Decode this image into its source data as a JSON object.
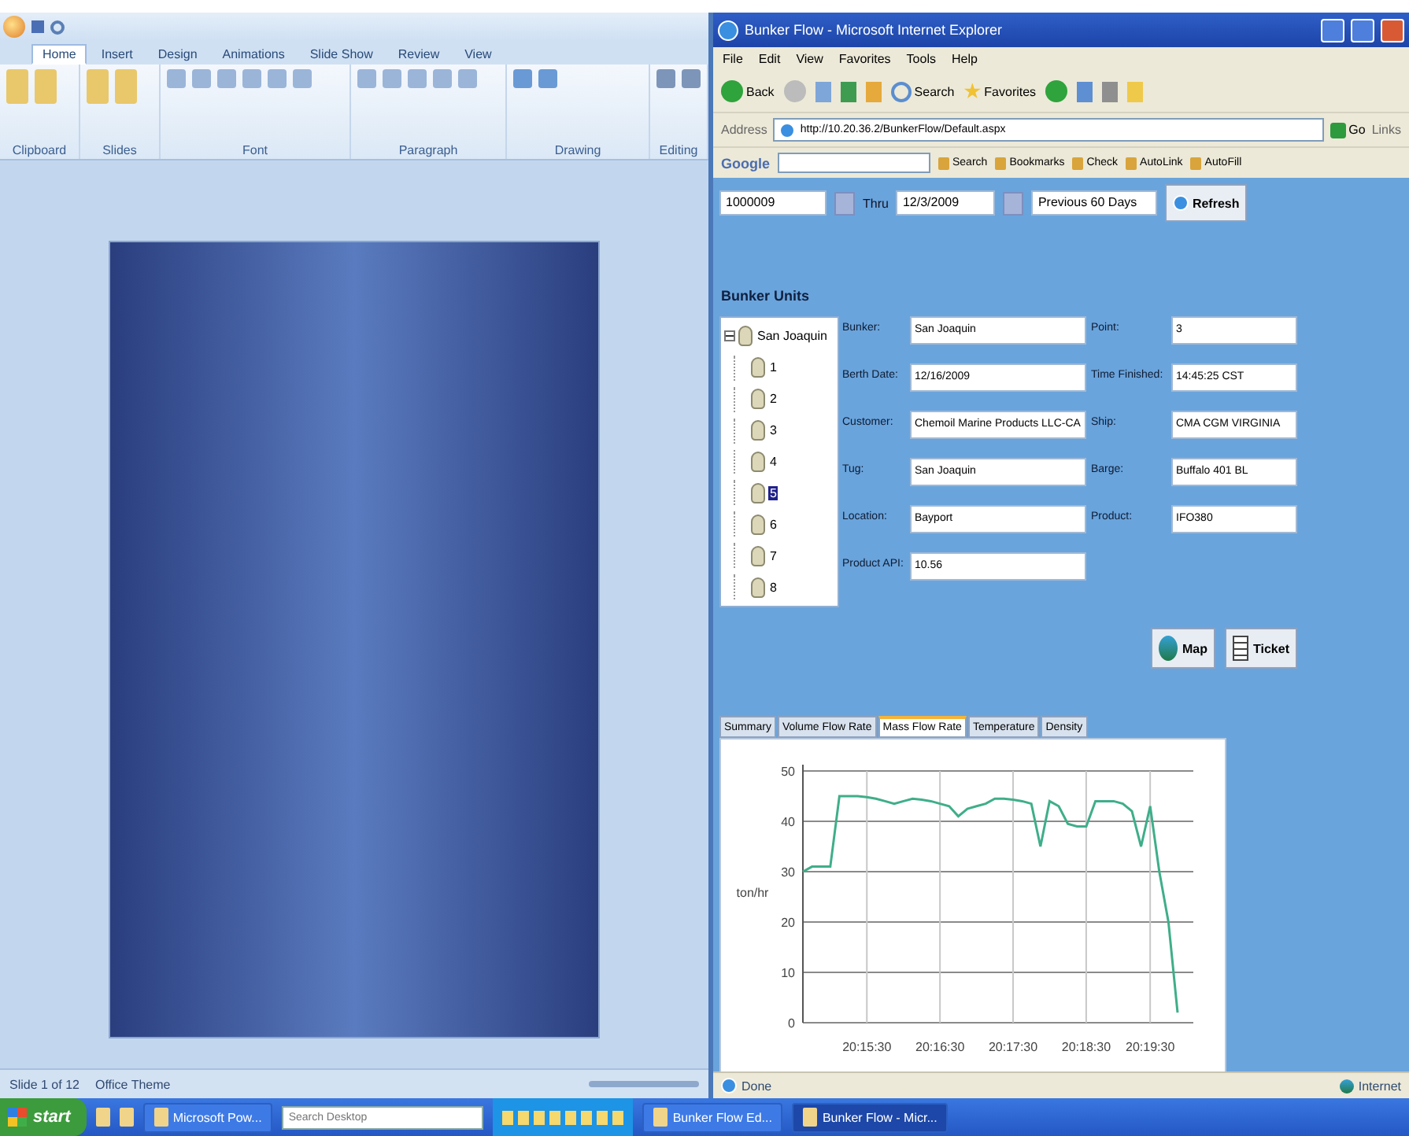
{
  "ppt_window": {
    "ribbon_tabs": [
      {
        "label": "Home",
        "selected": true
      },
      {
        "label": "Insert",
        "selected": false
      },
      {
        "label": "Design",
        "selected": false
      },
      {
        "label": "Animations",
        "selected": false
      },
      {
        "label": "Slide Show",
        "selected": false
      },
      {
        "label": "Review",
        "selected": false
      },
      {
        "label": "View",
        "selected": false
      }
    ],
    "ribbon_groups": [
      "Clipboard",
      "Slides",
      "Font",
      "Paragraph",
      "Drawing",
      "Editing"
    ],
    "status_bar": {
      "slide": "Slide 1 of 12",
      "theme": "Office Theme"
    }
  },
  "ie_window": {
    "title": "Bunker Flow - Microsoft Internet Explorer",
    "menu": [
      "File",
      "Edit",
      "View",
      "Favorites",
      "Tools",
      "Help"
    ],
    "toolbar": [
      "Back",
      "Search",
      "Favorites"
    ],
    "address": {
      "label": "Address",
      "value": "http://10.20.36.2/BunkerFlow/Default.aspx",
      "go": "Go",
      "links": "Links"
    },
    "google_toolbar": {
      "label": "Google",
      "buttons": [
        "Search",
        "Bookmarks",
        "Check",
        "AutoLink",
        "AutoFill"
      ]
    },
    "status_bar": {
      "left": "Done",
      "right": "Internet"
    }
  },
  "filter": {
    "from": "1000009",
    "thru_label": "Thru",
    "thru": "12/3/2009",
    "range": "Previous 60 Days",
    "refresh": "Refresh"
  },
  "section_title": "Bunker Units",
  "tree": {
    "label": "San Joaquin",
    "expanded": true,
    "children": [
      {
        "label": "1",
        "selected": false
      },
      {
        "label": "2",
        "selected": false
      },
      {
        "label": "3",
        "selected": false
      },
      {
        "label": "4",
        "selected": false
      },
      {
        "label": "5",
        "selected": true
      },
      {
        "label": "6",
        "selected": false
      },
      {
        "label": "7",
        "selected": false
      },
      {
        "label": "8",
        "selected": false
      }
    ]
  },
  "fields": [
    {
      "label": "Bunker:",
      "value": "San Joaquin"
    },
    {
      "label": "Point:",
      "value": "3"
    },
    {
      "label": "Berth Date:",
      "value": "12/16/2009"
    },
    {
      "label": "Time Finished:",
      "value": "14:45:25 CST"
    },
    {
      "label": "Customer:",
      "value": "Chemoil Marine Products LLC-CA"
    },
    {
      "label": "Ship:",
      "value": "CMA CGM VIRGINIA"
    },
    {
      "label": "Tug:",
      "value": "San Joaquin"
    },
    {
      "label": "Barge:",
      "value": "Buffalo 401 BL"
    },
    {
      "label": "Location:",
      "value": "Bayport"
    },
    {
      "label": "Product:",
      "value": "IFO380"
    },
    {
      "label": "Product API:",
      "value": "10.56"
    }
  ],
  "actions": [
    {
      "label": "Map",
      "kind": "map"
    },
    {
      "label": "Ticket",
      "kind": "ticket"
    }
  ],
  "chart_tabs": [
    {
      "label": "Summary",
      "selected": false
    },
    {
      "label": "Volume Flow Rate",
      "selected": false
    },
    {
      "label": "Mass Flow Rate",
      "selected": true
    },
    {
      "label": "Temperature",
      "selected": false
    },
    {
      "label": "Density",
      "selected": false
    }
  ],
  "chart_data": {
    "type": "line",
    "grid": true,
    "ylabel": "ton/hr",
    "ylim": [
      0,
      50
    ],
    "yticks": [
      0,
      10,
      20,
      30,
      40,
      50
    ],
    "categories": [
      null,
      null,
      null,
      null,
      null,
      null,
      null,
      "20:15:30",
      null,
      null,
      null,
      null,
      null,
      null,
      null,
      "20:16:30",
      null,
      null,
      null,
      null,
      null,
      null,
      null,
      "20:17:30",
      null,
      null,
      null,
      null,
      null,
      null,
      null,
      "20:18:30",
      null,
      null,
      null,
      null,
      null,
      null,
      "20:19:30",
      null,
      null,
      null
    ],
    "series": [
      {
        "color": "#3fae8a",
        "values": [
          30,
          31,
          31,
          31,
          45,
          45,
          45,
          44.8,
          44.5,
          44,
          43.5,
          44,
          44.5,
          44.3,
          44,
          43.5,
          43,
          41,
          42.5,
          43,
          43.5,
          44.5,
          44.5,
          44.3,
          44,
          43.5,
          35,
          44,
          43,
          39.5,
          39,
          39,
          44,
          44,
          44,
          43.5,
          42,
          35,
          43,
          30,
          20,
          2
        ]
      }
    ]
  },
  "taskbar": {
    "start": "start",
    "items": [
      {
        "label": "Microsoft Pow...",
        "selected": false
      },
      {
        "label": "Bunker Flow Ed...",
        "selected": false
      },
      {
        "label": "Bunker Flow - Micr...",
        "selected": true
      }
    ],
    "search": {
      "placeholder": "Search Desktop"
    }
  }
}
